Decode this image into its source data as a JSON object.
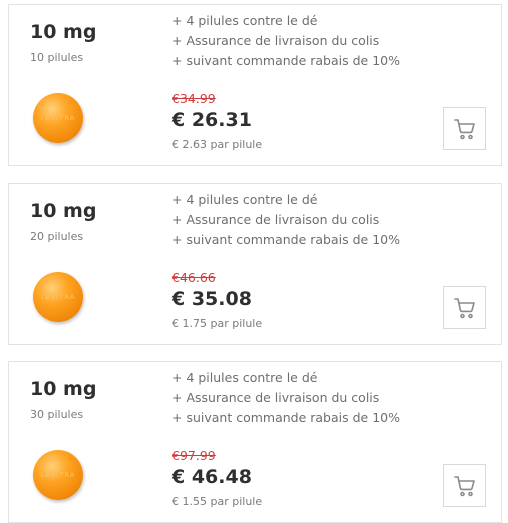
{
  "products": [
    {
      "dose": "10 mg",
      "pills_label": "10 pilules",
      "features": [
        "+ 4 pilules contre le dé",
        "+ Assurance de livraison du colis",
        "+ suivant commande rabais de 10%"
      ],
      "old_price": "€34.99",
      "price": "€ 26.31",
      "per_pill": "€ 2.63 par pilule",
      "pill_logo": "LEVITRA",
      "cart_icon": "shopping-cart-icon"
    },
    {
      "dose": "10 mg",
      "pills_label": "20 pilules",
      "features": [
        "+ 4 pilules contre le dé",
        "+ Assurance de livraison du colis",
        "+ suivant commande rabais de 10%"
      ],
      "old_price": "€46.66",
      "price": "€ 35.08",
      "per_pill": "€ 1.75 par pilule",
      "pill_logo": "LEVITRA",
      "cart_icon": "shopping-cart-icon"
    },
    {
      "dose": "10 mg",
      "pills_label": "30 pilules",
      "features": [
        "+ 4 pilules contre le dé",
        "+ Assurance de livraison du colis",
        "+ suivant commande rabais de 10%"
      ],
      "old_price": "€97.99",
      "price": "€ 46.48",
      "per_pill": "€ 1.55 par pilule",
      "pill_logo": "LEVITRA",
      "cart_icon": "shopping-cart-icon"
    }
  ],
  "colors": {
    "old_price": "#d23a3a",
    "pill_orange": "#f28a0a",
    "border": "#e3e3e3"
  }
}
